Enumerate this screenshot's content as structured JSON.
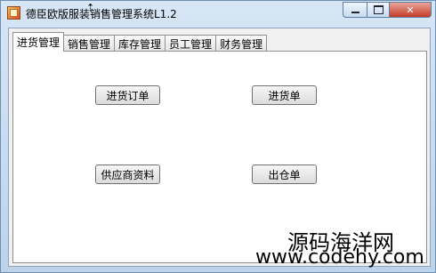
{
  "window": {
    "title": "德臣欧版服装销售管理系统L1.2",
    "close_glyph": "✕"
  },
  "tabs": [
    "进货管理",
    "销售管理",
    "库存管理",
    "员工管理",
    "财务管理"
  ],
  "buttons": {
    "purchase_order": "进货订单",
    "purchase_bill": "进货单",
    "supplier_info": "供应商资料",
    "outbound_bill": "出仓单"
  },
  "watermark": {
    "line1": "源码海洋网",
    "line2": "www.codehy.com"
  }
}
